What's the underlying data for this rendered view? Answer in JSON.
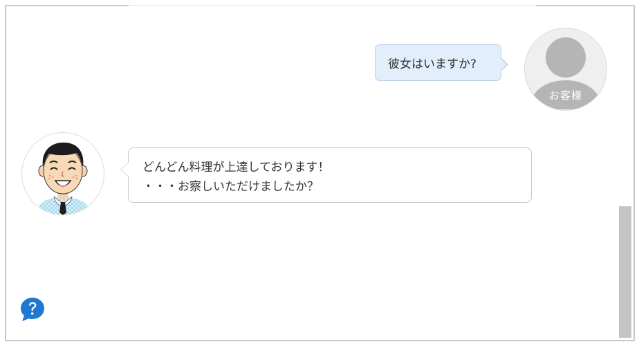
{
  "chat": {
    "customer_avatar_label": "お客様",
    "user_message": "彼女はいますか?",
    "bot_message_line1": "どんどん料理が上達しております！",
    "bot_message_line2": "・・・お察しいただけましたか？"
  },
  "icons": {
    "customer_avatar": "person-silhouette-icon",
    "staff_avatar": "smiling-staff-avatar",
    "help": "question-speech-bubble-icon"
  },
  "colors": {
    "user_bubble_bg": "#e3eefc",
    "user_bubble_border": "#b9cfea",
    "bot_bubble_border": "#c8c8c8",
    "help_icon": "#1f78d1",
    "scrollbar": "#c4c4c4"
  }
}
